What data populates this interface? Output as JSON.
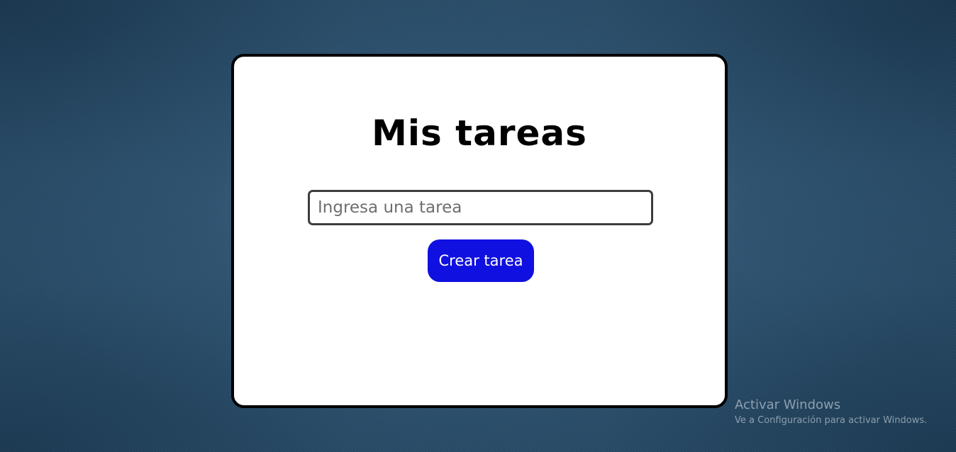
{
  "app": {
    "title": "Mis tareas"
  },
  "form": {
    "input_placeholder": "Ingresa una tarea",
    "input_value": "",
    "create_button_label": "Crear tarea"
  },
  "colors": {
    "button_background": "#1010e0",
    "card_background": "#ffffff",
    "card_border": "#000000",
    "page_background": "#2e5675"
  },
  "os_watermark": {
    "title": "Activar Windows",
    "subtitle": "Ve a Configuración para activar Windows."
  }
}
